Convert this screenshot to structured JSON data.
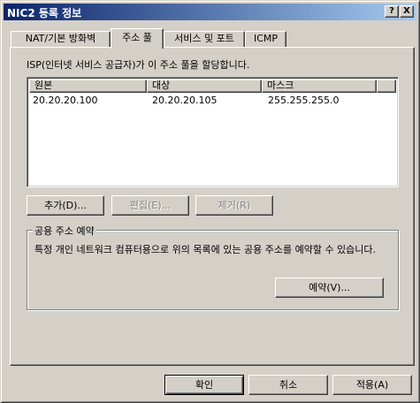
{
  "window": {
    "title": "NIC2 등록 정보",
    "help_button": "?",
    "close_button": "X"
  },
  "tabs": [
    {
      "label": "NAT/기본 방화벽"
    },
    {
      "label": "주소 풀"
    },
    {
      "label": "서비스 및 포트"
    },
    {
      "label": "ICMP"
    }
  ],
  "address_pool": {
    "description": "ISP(인터넷 서비스 공급자)가 이 주소 풀을 할당합니다.",
    "columns": [
      "원본",
      "대상",
      "마스크"
    ],
    "rows": [
      {
        "from": "20.20.20.100",
        "to": "20.20.20.105",
        "mask": "255.255.255.0"
      }
    ],
    "add_label": "추가(D)...",
    "edit_label": "편집(E)...",
    "remove_label": "제거(R)"
  },
  "reservation": {
    "title": "공용 주소 예약",
    "description": "특정 개인 네트워크 컴퓨터용으로 위의 목록에 있는 공용 주소를 예약할 수 있습니다.",
    "reserve_label": "예약(V)..."
  },
  "footer": {
    "ok_label": "확인",
    "cancel_label": "취소",
    "apply_label": "적용(A)"
  }
}
